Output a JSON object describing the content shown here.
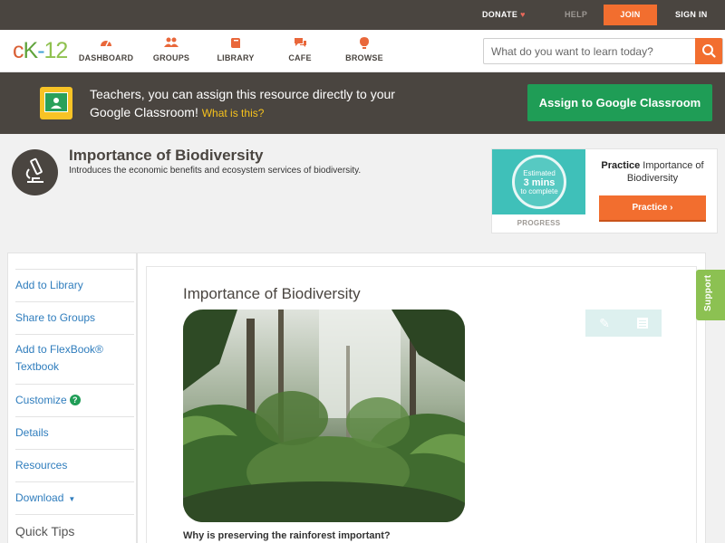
{
  "topbar": {
    "donate": "DONATE",
    "help": "HELP",
    "join": "JOIN",
    "signin": "SIGN IN"
  },
  "logo": {
    "c": "c",
    "k": "K",
    "dash": "-",
    "num": "12"
  },
  "nav": [
    {
      "label": "DASHBOARD",
      "icon": "dashboard-icon"
    },
    {
      "label": "GROUPS",
      "icon": "groups-icon"
    },
    {
      "label": "LIBRARY",
      "icon": "library-icon"
    },
    {
      "label": "CAFE",
      "icon": "cafe-icon"
    },
    {
      "label": "BROWSE",
      "icon": "browse-icon"
    }
  ],
  "search": {
    "placeholder": "What do you want to learn today?"
  },
  "banner": {
    "text": "Teachers, you can assign this resource directly to your Google Classroom!",
    "link": "What is this?",
    "button": "Assign to Google Classroom"
  },
  "concept": {
    "title": "Importance of Biodiversity",
    "subtitle": "Introduces the economic benefits and ecosystem services of biodiversity."
  },
  "practice": {
    "estimated": "Estimated",
    "mins": "3 mins",
    "complete": "to complete",
    "progress_label": "PROGRESS",
    "label_bold": "Practice",
    "label_rest": "Importance of Biodiversity",
    "button": "Practice"
  },
  "sidebar": {
    "items": [
      "Add to Library",
      "Share to Groups",
      "Add to FlexBook® Textbook",
      "Customize",
      "Details",
      "Resources",
      "Download"
    ],
    "tips": "Quick Tips"
  },
  "content": {
    "title": "Importance of Biodiversity",
    "question": "Why is preserving the rainforest important?"
  },
  "support": "Support",
  "colors": {
    "accent": "#f26e2f",
    "green": "#1f9d56",
    "dark": "#4a4540",
    "link": "#2f7dbd"
  }
}
